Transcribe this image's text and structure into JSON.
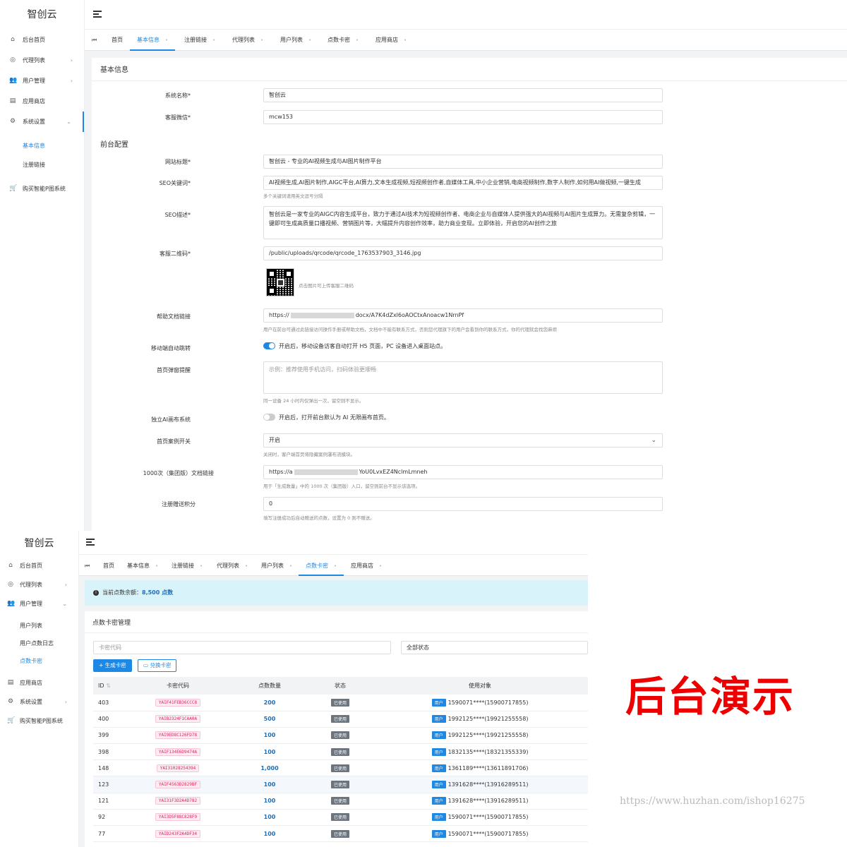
{
  "s1": {
    "logo": "智创云",
    "menu": {
      "home": "后台首页",
      "agents": "代理列表",
      "users": "用户管理",
      "store": "应用商店",
      "settings": "系统设置",
      "sub_basic": "基本信息",
      "sub_register": "注册链接",
      "buy": "购买智能P图系统"
    },
    "tabs": {
      "home": "首页",
      "basic": "基本信息",
      "register": "注册链接",
      "agents": "代理列表",
      "users": "用户列表",
      "cards": "点数卡密",
      "store": "应用商店"
    },
    "section_basic": "基本信息",
    "section_front": "前台配置",
    "labels": {
      "sys_name": "系统名称*",
      "wechat": "客服微信*",
      "site_title": "网站标题*",
      "seo_kw": "SEO关键词*",
      "seo_desc": "SEO描述*",
      "qrcode": "客服二维码*",
      "help_link": "帮助文档链接",
      "mobile_jump": "移动端自动跳转",
      "popup": "首页弹窗提醒",
      "ai_canvas": "独立AI画布系统",
      "case_switch": "首页案例开关",
      "k1000_link": "1000次（集团版）文档链接",
      "reg_points": "注册赠送积分"
    },
    "values": {
      "sys_name": "智创云",
      "wechat": "mcw153",
      "site_title": "智创云 - 专业的AI视频生成与AI图片制作平台",
      "seo_kw": "AI视频生成,AI图片制作,AIGC平台,AI算力,文本生成视频,短视频创作者,自媒体工具,中小企业营销,电商视频制作,数字人制作,如何用AI做视频,一键生成",
      "seo_desc": "智创云是一家专业的AIGC内容生成平台，致力于通过AI技术为短视频创作者、电商企业与自媒体人提供强大的AI视频与AI图片生成算力。无需复杂剪辑，一键即可生成高质量口播视频、营销图片等，大幅提升内容创作效率，助力商业变现。立即体验，开启您的AI创作之旅",
      "qrcode": "/public/uploads/qrcode/qrcode_1763537903_3146.jpg",
      "help_prefix": "https://",
      "help_suffix": "docx/A7K4dZxl6oAOCtxAnoacw1NrnPf",
      "popup_ph": "示例：推荐使用手机访问，扫码体验更顺畅",
      "case_switch": "开启",
      "k1000_prefix": "https://a",
      "k1000_suffix": "YoU0LvxEZ4NclmLmneh",
      "reg_points": "0"
    },
    "hints": {
      "seo_kw": "多个关键词请用英文逗号分隔",
      "qrcode": "点击图片可上传客服二维码",
      "help_link": "用户在前台可通过此链接访问操作手册或帮助文档，文档中不能有联系方式，否则您代理旗下的用户会看到你的联系方式，你的代理就会找您麻烦",
      "mobile_jump": "开启后，移动设备访客自动打开 H5 页面，PC 设备进入桌面站点。",
      "popup": "同一设备 24 小时内仅弹出一次，留空则不显示。",
      "ai_canvas": "开启后，打开前台默认为 AI 无限画布首页。",
      "case_switch": "关闭时，客户端首页将隐藏案例瀑布流模块。",
      "k1000_link": "用于「生成数量」中的 1000 次（集团版）入口，留空则前台不显示该选项。",
      "reg_points": "填写注册成功后自动赠送的点数，设置为 0 则不赠送。"
    },
    "toggles": {
      "mobile_jump": true,
      "ai_canvas": false
    }
  },
  "s2": {
    "logo": "智创云",
    "menu": {
      "home": "后台首页",
      "agents": "代理列表",
      "users": "用户管理",
      "sub_userlist": "用户列表",
      "sub_pointlog": "用户点数日志",
      "sub_cards": "点数卡密",
      "store": "应用商店",
      "settings": "系统设置",
      "buy": "购买智能P图系统"
    },
    "tabs": {
      "home": "首页",
      "basic": "基本信息",
      "register": "注册链接",
      "agents": "代理列表",
      "users": "用户列表",
      "cards": "点数卡密",
      "store": "应用商店"
    },
    "alert": {
      "text": "当前点数余额：",
      "value": "8,500 点数"
    },
    "panel_title": "点数卡密管理",
    "filter": {
      "code_ph": "卡密代码",
      "status": "全部状态"
    },
    "buttons": {
      "generate": "+ 生成卡密",
      "redeem": "兑换卡密"
    },
    "columns": [
      "ID",
      "卡密代码",
      "点数数量",
      "状态",
      "使用对象"
    ],
    "rows": [
      {
        "id": "403",
        "code": "YAIF41FEB36CCC8",
        "points": "200",
        "status": "已使用",
        "tag": "用户",
        "user": "1590071****(15900717855)"
      },
      {
        "id": "400",
        "code": "YAIB2324F1CAA0A",
        "points": "500",
        "status": "已使用",
        "tag": "用户",
        "user": "1992125****(19921255558)"
      },
      {
        "id": "399",
        "code": "YAI9ED8C126FD78",
        "points": "100",
        "status": "已使用",
        "tag": "用户",
        "user": "1992125****(19921255558)"
      },
      {
        "id": "398",
        "code": "YAIF134E6D9474A",
        "points": "100",
        "status": "已使用",
        "tag": "用户",
        "user": "1832135****(18321355339)"
      },
      {
        "id": "148",
        "code": "YAI31028254394",
        "points": "1,000",
        "status": "已使用",
        "tag": "用户",
        "user": "1361189****(13611891706)"
      },
      {
        "id": "123",
        "code": "YAIF4563D2829BF",
        "points": "100",
        "status": "已使用",
        "tag": "用户",
        "user": "1391628****(13916289511)"
      },
      {
        "id": "121",
        "code": "YAI31F3D2A4D782",
        "points": "100",
        "status": "已使用",
        "tag": "用户",
        "user": "1391628****(13916289511)"
      },
      {
        "id": "92",
        "code": "YAI3D5F88C828F9",
        "points": "100",
        "status": "已使用",
        "tag": "用户",
        "user": "1590071****(15900717855)"
      },
      {
        "id": "77",
        "code": "YAID243F2A4DF34",
        "points": "100",
        "status": "已使用",
        "tag": "用户",
        "user": "1590071****(15900717855)"
      }
    ]
  },
  "overlay": {
    "big": "后台演示",
    "watermark": "https://www.huzhan.com/ishop16275"
  },
  "colors": {
    "accent": "#1e88e5",
    "alert_bg": "#d9f3fb",
    "overlay_text": "#e00000"
  }
}
